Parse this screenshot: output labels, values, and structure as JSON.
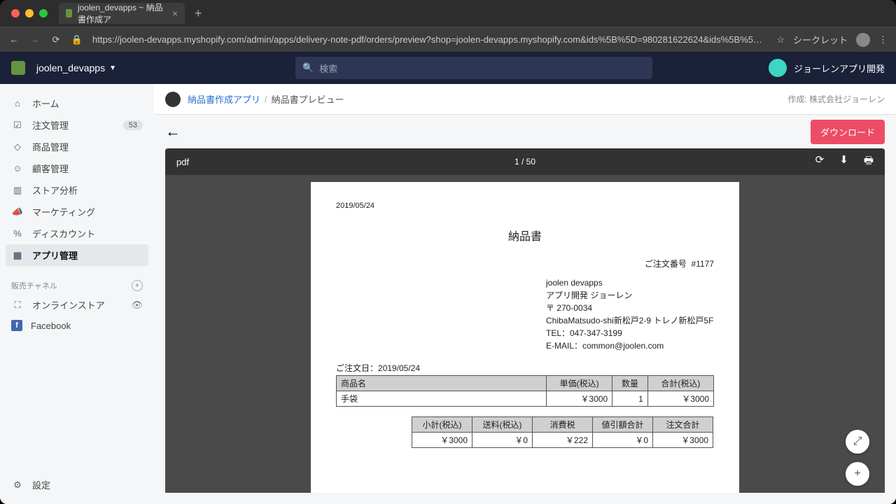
{
  "browser": {
    "tab_title": "joolen_devapps ~ 納品書作成ア",
    "url": "https://joolen-devapps.myshopify.com/admin/apps/delivery-note-pdf/orders/preview?shop=joolen-devapps.myshopify.com&ids%5B%5D=980281622624&ids%5B%5D=980279459936&i...",
    "incognito": "シークレット"
  },
  "header": {
    "shop_name": "joolen_devapps",
    "search_placeholder": "検索",
    "user_name": "ジョーレンアプリ開発"
  },
  "sidebar": {
    "items": [
      {
        "label": "ホーム"
      },
      {
        "label": "注文管理",
        "badge": "53"
      },
      {
        "label": "商品管理"
      },
      {
        "label": "顧客管理"
      },
      {
        "label": "ストア分析"
      },
      {
        "label": "マーケティング"
      },
      {
        "label": "ディスカウント"
      },
      {
        "label": "アプリ管理",
        "active": true
      }
    ],
    "channels_head": "販売チャネル",
    "channels": [
      {
        "label": "オンラインストア"
      },
      {
        "label": "Facebook"
      }
    ],
    "settings": "設定"
  },
  "breadcrumb": {
    "app": "納品書作成アプリ",
    "page": "納品書プレビュー",
    "created_by": "作成: 株式会社ジョーレン"
  },
  "actions": {
    "download": "ダウンロード"
  },
  "pdfviewer": {
    "title": "pdf",
    "page_indicator": "1 / 50"
  },
  "document": {
    "date": "2019/05/24",
    "title": "納品書",
    "order_number_label": "ご注文番号",
    "order_number": "#1177",
    "seller": {
      "name": "joolen devapps",
      "dept": "アプリ開発 ジョーレン",
      "postal": "〒 270-0034",
      "address": "ChibaMatsudo-shi新松戸2-9 トレノ新松戸5F",
      "tel": "TEL：047-347-3199",
      "email": "E-MAIL：common@joolen.com"
    },
    "order_date_label": "ご注文日：",
    "order_date": "2019/05/24",
    "items_header": {
      "name": "商品名",
      "unit": "単価(税込)",
      "qty": "数量",
      "total": "合計(税込)"
    },
    "items": [
      {
        "name": "手袋",
        "unit": "￥3000",
        "qty": "1",
        "total": "￥3000"
      }
    ],
    "summary": {
      "headers": {
        "subtotal": "小計(税込)",
        "shipping": "送料(税込)",
        "tax": "消費税",
        "discount": "値引額合計",
        "grand": "注文合計"
      },
      "values": {
        "subtotal": "￥3000",
        "shipping": "￥0",
        "tax": "￥222",
        "discount": "￥0",
        "grand": "￥3000"
      }
    }
  }
}
